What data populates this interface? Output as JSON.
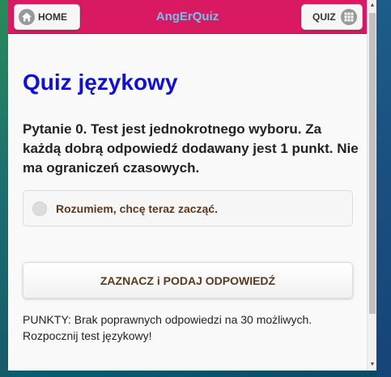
{
  "header": {
    "brand": "AngErQuiz",
    "home_label": "HOME",
    "quiz_label": "QUIZ",
    "background_color": "#d91a63",
    "brand_color": "#6cc3ef",
    "home_icon": "home-icon",
    "quiz_icon": "grid-icon"
  },
  "main": {
    "title": "Quiz językowy",
    "title_color": "#1010d0",
    "question": "Pytanie 0. Test jest jednokrotnego wyboru. Za każdą dobrą odpowiedź dodawany jest 1 punkt. Nie ma ograniczeń czasowych.",
    "options": [
      {
        "label": "Rozumiem, chcę teraz zacząć.",
        "selected": false
      }
    ],
    "submit_label": "ZAZNACZ i PODAJ ODPOWIEDŹ",
    "points_text": "PUNKTY: Brak poprawnych odpowiedzi na 30 możliwych. Rozpocznij test językowy!"
  }
}
